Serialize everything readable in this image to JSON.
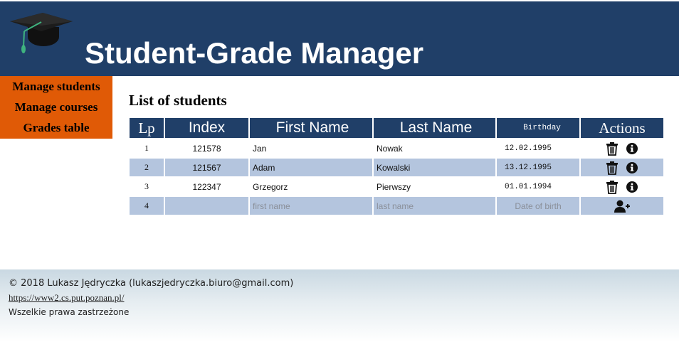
{
  "header": {
    "title": "Student-Grade Manager",
    "logo_icon": "graduation-cap-icon",
    "background": "#203f68"
  },
  "sidebar": {
    "background": "#e05a06",
    "items": [
      {
        "label": "Manage students"
      },
      {
        "label": "Manage courses"
      },
      {
        "label": "Grades table"
      }
    ]
  },
  "main": {
    "heading": "List of students",
    "table": {
      "columns": [
        "Lp",
        "Index",
        "First Name",
        "Last Name",
        "Birthday",
        "Actions"
      ],
      "rows": [
        {
          "lp": "1",
          "index": "121578",
          "first_name": "Jan",
          "last_name": "Nowak",
          "birthday": "12.02.1995"
        },
        {
          "lp": "2",
          "index": "121567",
          "first_name": "Adam",
          "last_name": "Kowalski",
          "birthday": "13.12.1995"
        },
        {
          "lp": "3",
          "index": "122347",
          "first_name": "Grzegorz",
          "last_name": "Pierwszy",
          "birthday": "01.01.1994"
        }
      ],
      "row_action_icons": [
        "trash-icon",
        "info-icon"
      ],
      "new_row": {
        "lp": "4",
        "index_value": "",
        "first_name_placeholder": "first name",
        "last_name_placeholder": "last name",
        "birthday_placeholder": "Date of birth",
        "action_icon": "add-user-icon"
      },
      "header_color": "#203f68",
      "alt_row_color": "#b4c5de"
    }
  },
  "footer": {
    "copyright": "© 2018 Lukasz Jędryczka (lukaszjedryczka.biuro@gmail.com)",
    "link": "https://www2.cs.put.poznan.pl/",
    "rights": "Wszelkie prawa zastrzeżone"
  }
}
